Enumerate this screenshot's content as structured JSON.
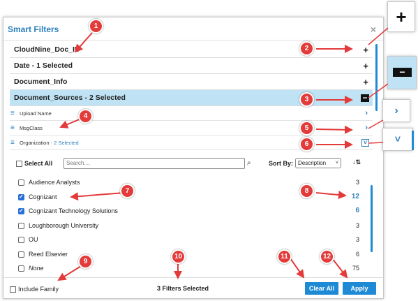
{
  "dialog": {
    "title": "Smart Filters",
    "close_label": "×"
  },
  "categories": [
    {
      "label": "CloudNine_Doc_ID",
      "action": "+"
    },
    {
      "label": "Date - 1 Selected",
      "action": "+"
    },
    {
      "label": "Document_Info",
      "action": "+"
    },
    {
      "label": "Document_Sources - 2 Selected",
      "action": "−"
    }
  ],
  "subfields": [
    {
      "label": "Upload Name",
      "suffix": "",
      "chevron": "›"
    },
    {
      "label": "MsgClass",
      "suffix": "",
      "chevron": "›"
    },
    {
      "label": "Organization",
      "suffix": " - 2 Selected",
      "chevron": "˅"
    }
  ],
  "toolbar": {
    "select_all_label": "Select All",
    "search_placeholder": "Search....",
    "sort_by_label": "Sort By:",
    "sort_value": "Description"
  },
  "values": [
    {
      "label": "Audience Analysts",
      "count": "3",
      "checked": false,
      "italic": false
    },
    {
      "label": "Cognizant",
      "count": "12",
      "checked": true,
      "italic": false
    },
    {
      "label": "Cognizant Technology Solutions",
      "count": "6",
      "checked": true,
      "italic": false
    },
    {
      "label": "Loughborough University",
      "count": "3",
      "checked": false,
      "italic": false
    },
    {
      "label": "OU",
      "count": "3",
      "checked": false,
      "italic": false
    },
    {
      "label": "Reed Elsevier",
      "count": "6",
      "checked": false,
      "italic": false
    },
    {
      "label": "None",
      "count": "75",
      "checked": false,
      "italic": true
    }
  ],
  "footer": {
    "include_family_label": "Include Family",
    "filters_selected": "3 Filters Selected",
    "clear_all_label": "Clear All",
    "apply_label": "Apply"
  },
  "callouts": [
    "1",
    "2",
    "3",
    "4",
    "5",
    "6",
    "7",
    "8",
    "9",
    "10",
    "11",
    "12"
  ],
  "zoom_icons": {
    "plus": "+",
    "minus": "−",
    "chevron_right": "›",
    "chevron_down": "˅"
  },
  "colors": {
    "accent": "#1e8ad6",
    "title": "#2a7fbf",
    "selected_row": "#bfe3f5",
    "callout": "#e33a3a"
  }
}
